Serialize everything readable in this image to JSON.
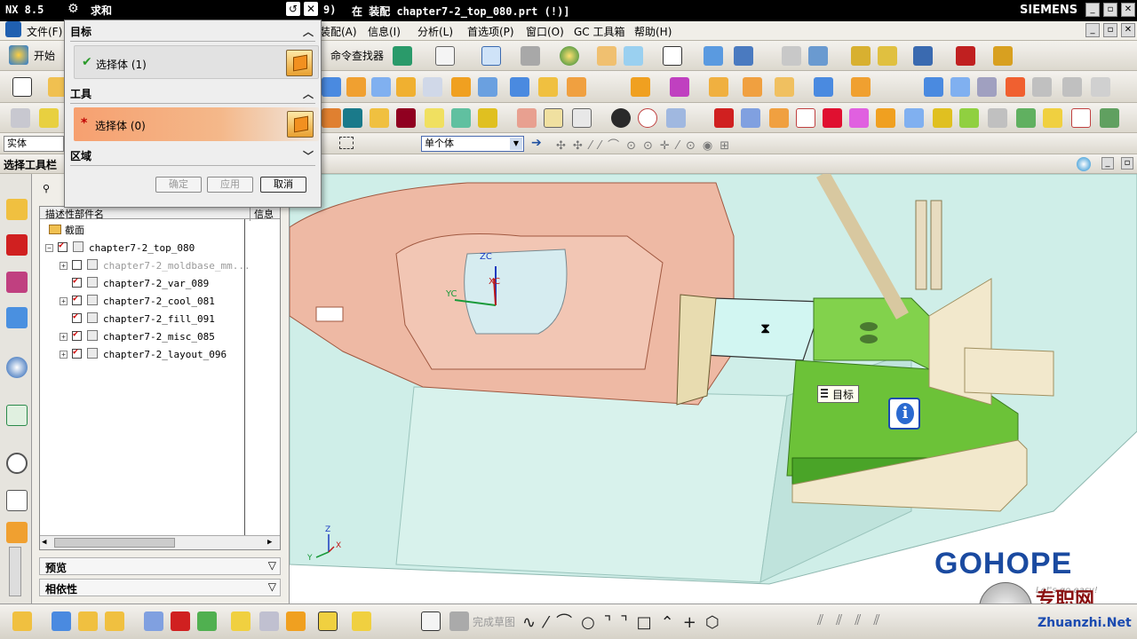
{
  "titlebar": {
    "app_name": "NX 8.5",
    "window_title": "在 装配 chapter7-2_top_080.prt  (!)]",
    "title_fragment": "9)",
    "brand": "SIEMENS"
  },
  "menubar": {
    "items": [
      "文件(F)",
      "装配(A)",
      "信息(I)",
      "分析(L)",
      "首选项(P)",
      "窗口(O)",
      "GC 工具箱",
      "帮助(H)"
    ]
  },
  "toolbar": {
    "start_label": "开始",
    "command_finder_label": "命令查找器",
    "type_filter_value": "实体",
    "selection_scope_value": "单个体",
    "selection_toolbar_label": "选择工具栏",
    "finish_sketch_label": "完成草图"
  },
  "dialog": {
    "title": "求和",
    "target_section": "目标",
    "target_select": "选择体 (1)",
    "tool_section": "工具",
    "tool_select": "选择体 (0)",
    "region_section": "区域",
    "ok_label": "确定",
    "apply_label": "应用",
    "cancel_label": "取消"
  },
  "navigator": {
    "column_name": "描述性部件名",
    "column_info": "信息",
    "section_folder": "截面",
    "tree": [
      {
        "name": "chapter7-2_top_080",
        "checked": true,
        "dim": false,
        "level": 0
      },
      {
        "name": "chapter7-2_moldbase_mm...",
        "checked": false,
        "dim": true,
        "level": 1
      },
      {
        "name": "chapter7-2_var_089",
        "checked": true,
        "dim": false,
        "level": 1
      },
      {
        "name": "chapter7-2_cool_081",
        "checked": true,
        "dim": false,
        "level": 1
      },
      {
        "name": "chapter7-2_fill_091",
        "checked": true,
        "dim": false,
        "level": 1
      },
      {
        "name": "chapter7-2_misc_085",
        "checked": true,
        "dim": false,
        "level": 1
      },
      {
        "name": "chapter7-2_layout_096",
        "checked": true,
        "dim": false,
        "level": 1
      }
    ],
    "preview_section": "预览",
    "dependency_section": "相依性"
  },
  "viewport": {
    "axis_zc": "ZC",
    "axis_yc": "YC",
    "axis_xc": "XC",
    "triad_z": "Z",
    "triad_y": "Y",
    "triad_x": "X",
    "tooltip_label": "目标",
    "info_icon_text": "i",
    "watermark_brand": "GOHOPE",
    "watermark_slogan": "Let's go easy!",
    "watermark_site_cn": "专职网",
    "watermark_site": "Zhuanzhi.Net"
  },
  "colors": {
    "mold_orange": "#e8a890",
    "mold_cyan": "#bfe6de",
    "block_green": "#6fc83a",
    "plate_tan": "#f0e6cc",
    "dialog_tool_orange": "#f0a070"
  }
}
